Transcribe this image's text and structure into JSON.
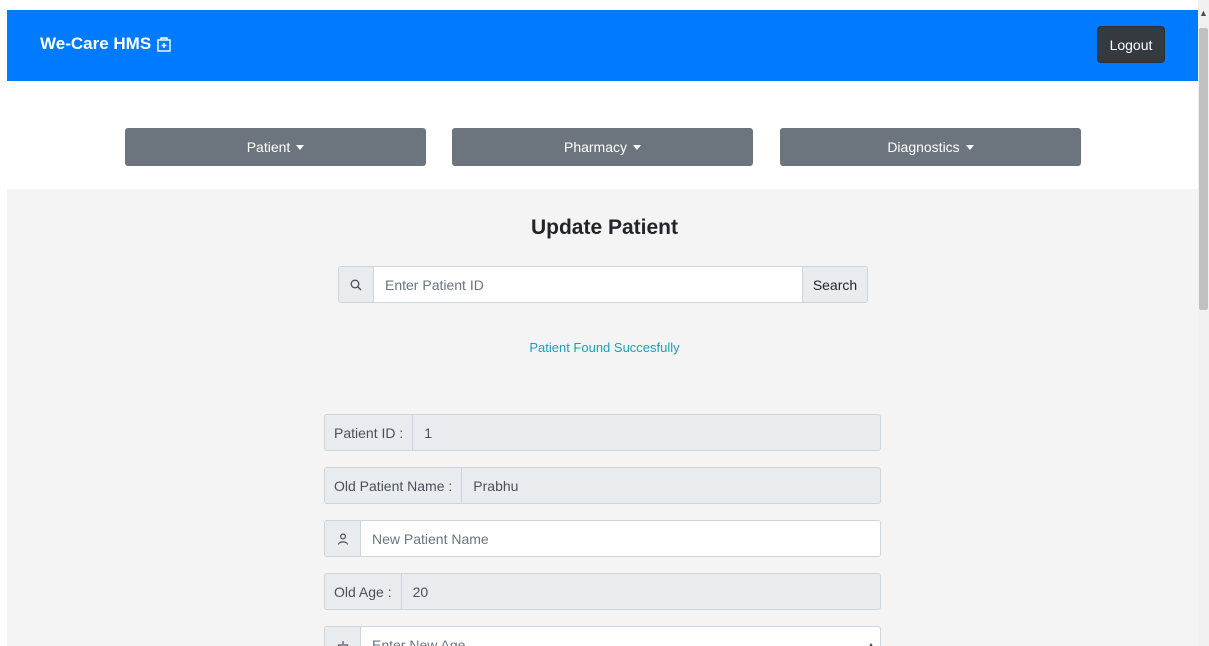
{
  "navbar": {
    "brand": "We-Care HMS",
    "logout_label": "Logout",
    "brand_color": "#007bff"
  },
  "menu": [
    {
      "label": "Patient"
    },
    {
      "label": "Pharmacy"
    },
    {
      "label": "Diagnostics"
    }
  ],
  "page": {
    "title": "Update Patient"
  },
  "search": {
    "placeholder": "Enter Patient ID",
    "button_label": "Search",
    "icon": "search-icon"
  },
  "status_message": "Patient Found Succesfully",
  "fields": {
    "patient_id": {
      "label": "Patient ID :",
      "value": "1"
    },
    "old_name": {
      "label": "Old Patient Name :",
      "value": "Prabhu"
    },
    "new_name": {
      "placeholder": "New Patient Name",
      "icon": "user-icon"
    },
    "old_age": {
      "label": "Old Age :",
      "value": "20"
    },
    "new_age": {
      "placeholder": "Enter New Age",
      "icon": "cake-icon"
    }
  }
}
